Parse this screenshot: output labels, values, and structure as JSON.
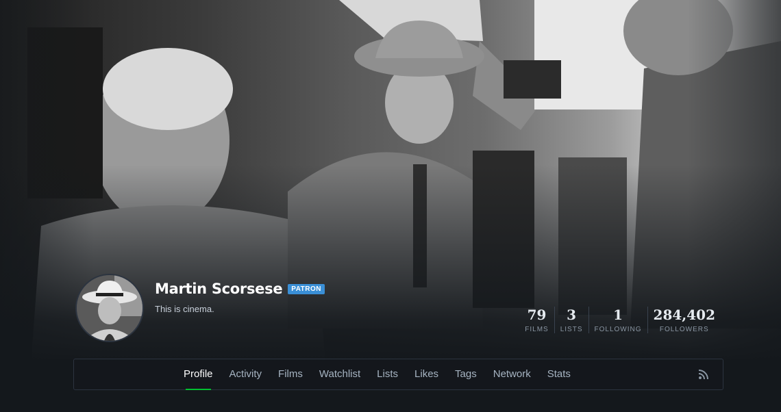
{
  "profile": {
    "name": "Martin Scorsese",
    "badge": "PATRON",
    "bio": "This is cinema.",
    "avatar_icon": "user-avatar-photo"
  },
  "stats": [
    {
      "value": "79",
      "label": "FILMS"
    },
    {
      "value": "3",
      "label": "LISTS"
    },
    {
      "value": "1",
      "label": "FOLLOWING"
    },
    {
      "value": "284,402",
      "label": "FOLLOWERS"
    }
  ],
  "nav": {
    "items": [
      {
        "label": "Profile",
        "active": true
      },
      {
        "label": "Activity"
      },
      {
        "label": "Films"
      },
      {
        "label": "Watchlist"
      },
      {
        "label": "Lists"
      },
      {
        "label": "Likes"
      },
      {
        "label": "Tags"
      },
      {
        "label": "Network"
      },
      {
        "label": "Stats"
      }
    ],
    "rss_icon": "rss-icon"
  },
  "colors": {
    "background": "#14181c",
    "accent_green": "#00c030",
    "badge_blue": "#3a8fd6"
  }
}
